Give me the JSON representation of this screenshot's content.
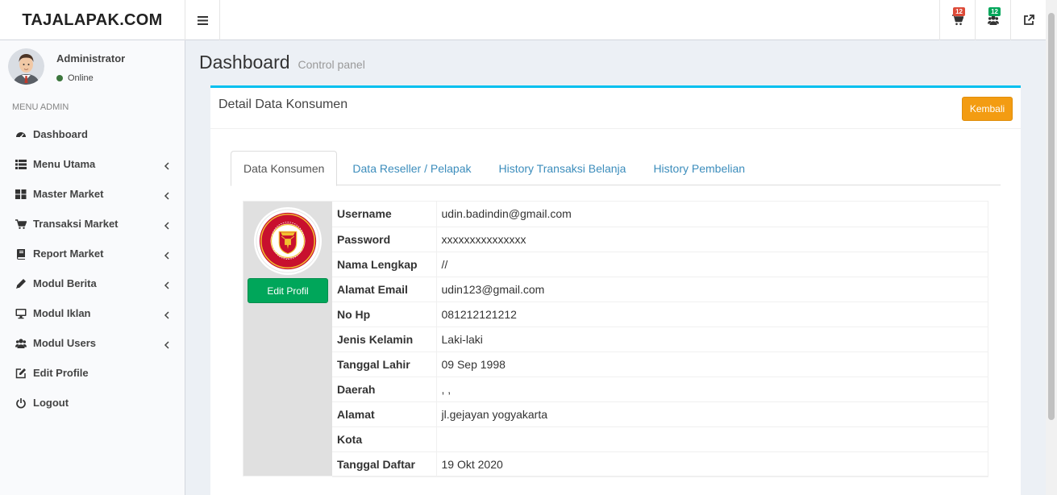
{
  "brand": "TAJALAPAK.COM",
  "header": {
    "cart_badge": "12",
    "cart_badge_color": "#dd4b39",
    "users_badge": "12",
    "users_badge_color": "#00a65a"
  },
  "sidebar": {
    "user_name": "Administrator",
    "user_status": "Online",
    "menu_header": "MENU ADMIN",
    "items": [
      {
        "label": "Dashboard",
        "icon": "dashboard-icon",
        "submenu": false
      },
      {
        "label": "Menu Utama",
        "icon": "list-icon",
        "submenu": true
      },
      {
        "label": "Master Market",
        "icon": "th-large-icon",
        "submenu": true
      },
      {
        "label": "Transaksi Market",
        "icon": "cart-icon",
        "submenu": true
      },
      {
        "label": "Report Market",
        "icon": "book-icon",
        "submenu": true
      },
      {
        "label": "Modul Berita",
        "icon": "pencil-icon",
        "submenu": true
      },
      {
        "label": "Modul Iklan",
        "icon": "desktop-icon",
        "submenu": true
      },
      {
        "label": "Modul Users",
        "icon": "users-icon",
        "submenu": true
      },
      {
        "label": "Edit Profile",
        "icon": "edit-icon",
        "submenu": false
      },
      {
        "label": "Logout",
        "icon": "power-icon",
        "submenu": false
      }
    ]
  },
  "page": {
    "title": "Dashboard",
    "subtitle": "Control panel"
  },
  "box": {
    "title": "Detail Data Konsumen",
    "back_label": "Kembali",
    "tabs": [
      "Data Konsumen",
      "Data Reseller / Pelapak",
      "History Transaksi Belanja",
      "History Pembelian"
    ],
    "edit_label": "Edit Profil",
    "rows": [
      {
        "key": "Username",
        "value": "udin.badindin@gmail.com"
      },
      {
        "key": "Password",
        "value": "xxxxxxxxxxxxxxx"
      },
      {
        "key": "Nama Lengkap",
        "value": "//"
      },
      {
        "key": "Alamat Email",
        "value": "udin123@gmail.com"
      },
      {
        "key": "No Hp",
        "value": "081212121212"
      },
      {
        "key": "Jenis Kelamin",
        "value": "Laki-laki"
      },
      {
        "key": "Tanggal Lahir",
        "value": "09 Sep 1998"
      },
      {
        "key": "Daerah",
        "value": ", ,"
      },
      {
        "key": "Alamat",
        "value": "jl.gejayan yogyakarta"
      },
      {
        "key": "Kota",
        "value": ""
      },
      {
        "key": "Tanggal Daftar",
        "value": "19 Okt 2020"
      }
    ]
  }
}
